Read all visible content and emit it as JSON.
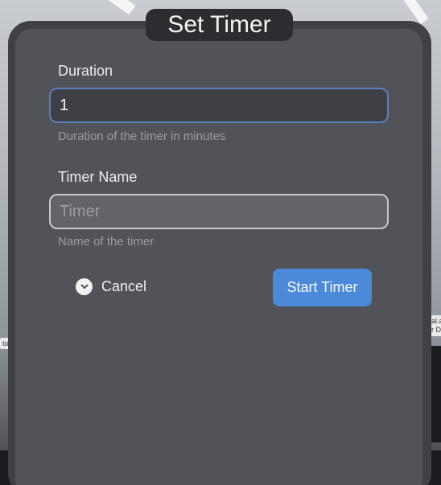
{
  "dialog": {
    "title": "Set Timer"
  },
  "duration": {
    "label": "Duration",
    "value": "1",
    "helper": "Duration of the timer in minutes"
  },
  "timer_name": {
    "label": "Timer Name",
    "placeholder": "Timer",
    "helper": "Name of the timer"
  },
  "actions": {
    "cancel_label": "Cancel",
    "start_label": "Start Timer"
  },
  "background": {
    "left_tag": "to",
    "right_tag": "al.a\nr D"
  },
  "colors": {
    "panel": "#515358",
    "accent": "#4b89d9",
    "focus_border": "#5a7fbd"
  }
}
